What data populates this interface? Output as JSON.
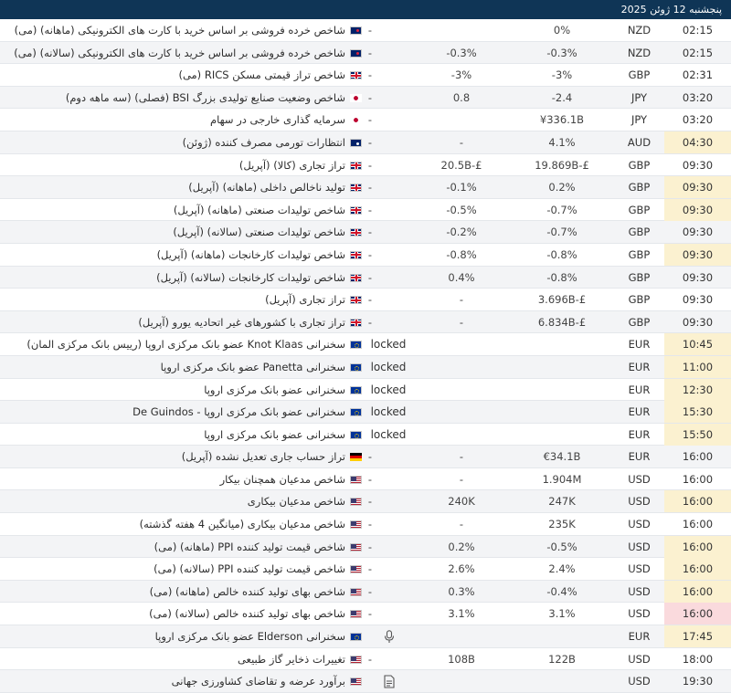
{
  "header": {
    "date": "پنجشنبه 12 ژوئن 2025"
  },
  "rows": [
    {
      "time": "02:15",
      "hl": "",
      "currency": "NZD",
      "flag": "NZD",
      "actual": "0%",
      "forecast": "",
      "previous": "-",
      "event": "شاخص خرده فروشی بر اساس خرید با کارت های الکترونیکی (ماهانه) (می)",
      "extra": ""
    },
    {
      "time": "02:15",
      "hl": "",
      "currency": "NZD",
      "flag": "NZD",
      "actual": "-0.3%",
      "forecast": "-0.3%",
      "previous": "-",
      "event": "شاخص خرده فروشی بر اساس خرید با کارت های الکترونیکی (سالانه) (می)",
      "extra": ""
    },
    {
      "time": "02:31",
      "hl": "",
      "currency": "GBP",
      "flag": "GBP",
      "actual": "-3%",
      "forecast": "-3%",
      "previous": "-",
      "event": "شاخص تراز قیمتی مسکن RICS (می)",
      "extra": ""
    },
    {
      "time": "03:20",
      "hl": "",
      "currency": "JPY",
      "flag": "JPY",
      "actual": "-2.4",
      "forecast": "0.8",
      "previous": "-",
      "event": "شاخص وضعیت صنایع تولیدی بزرگ BSI (فصلی) (سه ماهه دوم)",
      "extra": ""
    },
    {
      "time": "03:20",
      "hl": "",
      "currency": "JPY",
      "flag": "JPY",
      "actual": "¥336.1B",
      "forecast": "",
      "previous": "-",
      "event": "سرمایه گذاری خارجی در سهام",
      "extra": ""
    },
    {
      "time": "04:30",
      "hl": "yellow",
      "currency": "AUD",
      "flag": "AUD",
      "actual": "4.1%",
      "forecast": "-",
      "previous": "-",
      "event": "انتظارات تورمی مصرف کننده (ژوئن)",
      "extra": ""
    },
    {
      "time": "09:30",
      "hl": "",
      "currency": "GBP",
      "flag": "GBP",
      "actual": "19.869B-£",
      "forecast": "20.5B-£",
      "previous": "-",
      "event": "تراز تجاری (کالا) (آپریل)",
      "extra": ""
    },
    {
      "time": "09:30",
      "hl": "yellow",
      "currency": "GBP",
      "flag": "GBP",
      "actual": "0.2%",
      "forecast": "-0.1%",
      "previous": "-",
      "event": "تولید ناخالص داخلی (ماهانه) (آپریل)",
      "extra": ""
    },
    {
      "time": "09:30",
      "hl": "yellow",
      "currency": "GBP",
      "flag": "GBP",
      "actual": "-0.7%",
      "forecast": "-0.5%",
      "previous": "-",
      "event": "شاخص تولیدات صنعتی (ماهانه) (آپریل)",
      "extra": ""
    },
    {
      "time": "09:30",
      "hl": "",
      "currency": "GBP",
      "flag": "GBP",
      "actual": "-0.7%",
      "forecast": "-0.2%",
      "previous": "-",
      "event": "شاخص تولیدات صنعتی (سالانه) (آپریل)",
      "extra": ""
    },
    {
      "time": "09:30",
      "hl": "yellow",
      "currency": "GBP",
      "flag": "GBP",
      "actual": "-0.8%",
      "forecast": "-0.8%",
      "previous": "-",
      "event": "شاخص تولیدات کارخانجات (ماهانه) (آپریل)",
      "extra": ""
    },
    {
      "time": "09:30",
      "hl": "",
      "currency": "GBP",
      "flag": "GBP",
      "actual": "-0.8%",
      "forecast": "0.4%",
      "previous": "-",
      "event": "شاخص تولیدات کارخانجات (سالانه) (آپریل)",
      "extra": ""
    },
    {
      "time": "09:30",
      "hl": "",
      "currency": "GBP",
      "flag": "GBP",
      "actual": "3.696B-£",
      "forecast": "-",
      "previous": "-",
      "event": "تراز تجاری (آپریل)",
      "extra": ""
    },
    {
      "time": "09:30",
      "hl": "",
      "currency": "GBP",
      "flag": "GBP",
      "actual": "6.834B-£",
      "forecast": "-",
      "previous": "-",
      "event": "تراز تجاری با کشورهای غیر اتحادیه یورو (آپریل)",
      "extra": ""
    },
    {
      "time": "10:45",
      "hl": "yellow",
      "currency": "EUR",
      "flag": "EUR",
      "actual": "",
      "forecast": "",
      "previous": "",
      "event": "سخنرانی Knot Klaas عضو بانک مرکزی اروپا (رییس بانک مرکزی المان)",
      "extra": "locked"
    },
    {
      "time": "11:00",
      "hl": "yellow",
      "currency": "EUR",
      "flag": "EUR",
      "actual": "",
      "forecast": "",
      "previous": "",
      "event": "سخنرانی Panetta عضو بانک مرکزی اروپا",
      "extra": "locked"
    },
    {
      "time": "12:30",
      "hl": "yellow",
      "currency": "EUR",
      "flag": "EUR",
      "actual": "",
      "forecast": "",
      "previous": "",
      "event": "سخنرانی عضو بانک مرکزی اروپا",
      "extra": "locked"
    },
    {
      "time": "15:30",
      "hl": "yellow",
      "currency": "EUR",
      "flag": "EUR",
      "actual": "",
      "forecast": "",
      "previous": "",
      "event": "سخنرانی عضو بانک مرکزی اروپا - De Guindos",
      "extra": "locked"
    },
    {
      "time": "15:50",
      "hl": "yellow",
      "currency": "EUR",
      "flag": "EUR",
      "actual": "",
      "forecast": "",
      "previous": "",
      "event": "سخنرانی عضو بانک مرکزی اروپا",
      "extra": "locked"
    },
    {
      "time": "16:00",
      "hl": "",
      "currency": "EUR",
      "flag": "DEU",
      "actual": "€34.1B",
      "forecast": "-",
      "previous": "-",
      "event": "تراز حساب جاری تعدیل نشده (آپریل)",
      "extra": ""
    },
    {
      "time": "16:00",
      "hl": "",
      "currency": "USD",
      "flag": "USD",
      "actual": "1.904M",
      "forecast": "-",
      "previous": "-",
      "event": "شاخص مدعیان همچنان بیکار",
      "extra": ""
    },
    {
      "time": "16:00",
      "hl": "yellow",
      "currency": "USD",
      "flag": "USD",
      "actual": "247K",
      "forecast": "240K",
      "previous": "-",
      "event": "شاخص مدعیان بیکاری",
      "extra": ""
    },
    {
      "time": "16:00",
      "hl": "",
      "currency": "USD",
      "flag": "USD",
      "actual": "235K",
      "forecast": "-",
      "previous": "-",
      "event": "شاخص مدعیان بیکاری (میانگین 4 هفته گذشته)",
      "extra": ""
    },
    {
      "time": "16:00",
      "hl": "yellow",
      "currency": "USD",
      "flag": "USD",
      "actual": "-0.5%",
      "forecast": "0.2%",
      "previous": "-",
      "event": "شاخص قیمت تولید کننده PPI (ماهانه) (می)",
      "extra": ""
    },
    {
      "time": "16:00",
      "hl": "yellow",
      "currency": "USD",
      "flag": "USD",
      "actual": "2.4%",
      "forecast": "2.6%",
      "previous": "-",
      "event": "شاخص قیمت تولید کننده PPI (سالانه) (می)",
      "extra": ""
    },
    {
      "time": "16:00",
      "hl": "yellow",
      "currency": "USD",
      "flag": "USD",
      "actual": "-0.4%",
      "forecast": "0.3%",
      "previous": "-",
      "event": "شاخص بهای تولید کننده خالص (ماهانه) (می)",
      "extra": ""
    },
    {
      "time": "16:00",
      "hl": "pink",
      "currency": "USD",
      "flag": "USD",
      "actual": "3.1%",
      "forecast": "3.1%",
      "previous": "-",
      "event": "شاخص بهای تولید کننده خالص (سالانه) (می)",
      "extra": ""
    },
    {
      "time": "17:45",
      "hl": "yellow",
      "currency": "EUR",
      "flag": "EUR",
      "actual": "",
      "forecast": "",
      "previous": "",
      "event": "سخنرانی Elderson عضو بانک مرکزی اروپا",
      "extra": "mic"
    },
    {
      "time": "18:00",
      "hl": "",
      "currency": "USD",
      "flag": "USD",
      "actual": "122B",
      "forecast": "108B",
      "previous": "-",
      "event": "تغییرات ذخایر گاز طبیعی",
      "extra": ""
    },
    {
      "time": "19:30",
      "hl": "",
      "currency": "USD",
      "flag": "USD",
      "actual": "",
      "forecast": "",
      "previous": "",
      "event": "برآورد عرضه و تقاضای کشاورزی جهانی",
      "extra": "doc"
    }
  ]
}
